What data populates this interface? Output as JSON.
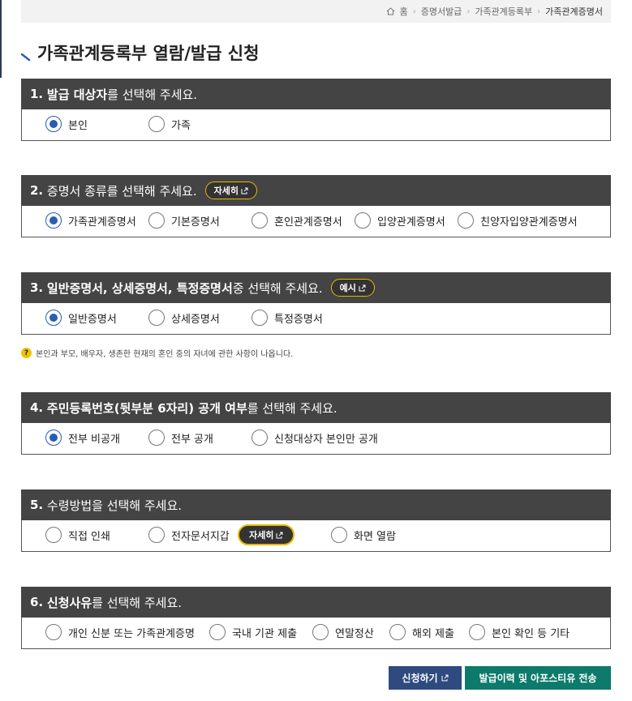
{
  "breadcrumb": {
    "home": "홈",
    "items": [
      "증명서발급",
      "가족관계등록부",
      "가족관계증명서"
    ]
  },
  "page_title": "가족관계등록부 열람/발급 신청",
  "sections": [
    {
      "num": "1.",
      "bold": "발급 대상자",
      "rest": "를 선택해 주세요.",
      "options": [
        "본인",
        "가족"
      ]
    },
    {
      "num": "2.",
      "bold": "증명서 종류",
      "rest": "를 선택해 주세요.",
      "button": "자세히",
      "options": [
        "가족관계증명서",
        "기본증명서",
        "혼인관계증명서",
        "입양관계증명서",
        "친양자입양관계증명서"
      ]
    },
    {
      "num": "3.",
      "bold": "일반증명서, 상세증명서, 특정증명서",
      "rest": " 중 선택해 주세요.",
      "button": "예시",
      "options": [
        "일반증명서",
        "상세증명서",
        "특정증명서"
      ]
    },
    {
      "num": "4.",
      "bold": "주민등록번호(뒷부분 6자리) 공개 여부",
      "rest": "를 선택해 주세요.",
      "options": [
        "전부 비공개",
        "전부 공개",
        "신청대상자 본인만 공개"
      ]
    },
    {
      "num": "5.",
      "bold": "수령방법",
      "rest": "을 선택해 주세요.",
      "inline_button": "자세히",
      "options": [
        "직접 인쇄",
        "전자문서지갑",
        "화면 열람"
      ]
    },
    {
      "num": "6.",
      "bold": "신청사유",
      "rest": "를 선택해 주세요.",
      "options": [
        "개인 신분 또는 가족관계증명",
        "국내 기관 제출",
        "연말정산",
        "해외 제출",
        "본인 확인 등 기타"
      ]
    }
  ],
  "note": "본인과 부모, 배우자, 생존한 현재의 혼인 중의 자녀에 관한 사항이 나옵니다.",
  "buttons": {
    "apply": "신청하기",
    "history": "발급이력 및 아포스티유 전송"
  },
  "colors": {
    "header_bg": "#444444",
    "radio_selected": "#2a5db0",
    "pill_border": "#e6b800",
    "apply_button": "#2e4a7f",
    "history_button": "#0d7a6b"
  }
}
